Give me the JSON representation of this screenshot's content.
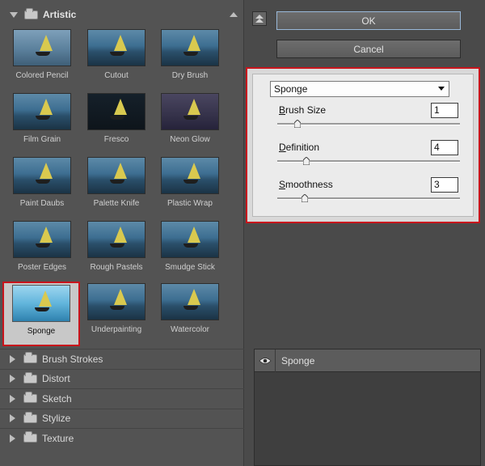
{
  "gallery": {
    "open_group": "Artistic",
    "thumbnails": [
      {
        "label": "Colored Pencil",
        "style": "pencil"
      },
      {
        "label": "Cutout",
        "style": ""
      },
      {
        "label": "Dry Brush",
        "style": ""
      },
      {
        "label": "Film Grain",
        "style": ""
      },
      {
        "label": "Fresco",
        "style": "dark"
      },
      {
        "label": "Neon Glow",
        "style": "purple"
      },
      {
        "label": "Paint Daubs",
        "style": ""
      },
      {
        "label": "Palette Knife",
        "style": ""
      },
      {
        "label": "Plastic Wrap",
        "style": ""
      },
      {
        "label": "Poster Edges",
        "style": ""
      },
      {
        "label": "Rough Pastels",
        "style": ""
      },
      {
        "label": "Smudge Stick",
        "style": ""
      },
      {
        "label": "Sponge",
        "style": "selected"
      },
      {
        "label": "Underpainting",
        "style": ""
      },
      {
        "label": "Watercolor",
        "style": ""
      }
    ],
    "collapsed_groups": [
      "Brush Strokes",
      "Distort",
      "Sketch",
      "Stylize",
      "Texture"
    ]
  },
  "buttons": {
    "ok": "OK",
    "cancel": "Cancel"
  },
  "options": {
    "filter": "Sponge",
    "params": [
      {
        "label_first": "B",
        "label_rest": "rush Size",
        "value": "1",
        "fraction": 0.11
      },
      {
        "label_first": "D",
        "label_rest": "efinition",
        "value": "4",
        "fraction": 0.16
      },
      {
        "label_first": "S",
        "label_rest": "moothness",
        "value": "3",
        "fraction": 0.15
      }
    ]
  },
  "layer": {
    "label": "Sponge",
    "icon": "eye-icon"
  },
  "colors": {
    "highlight": "#c8141c",
    "panel": "#535353",
    "options_bg": "#ebebeb"
  }
}
